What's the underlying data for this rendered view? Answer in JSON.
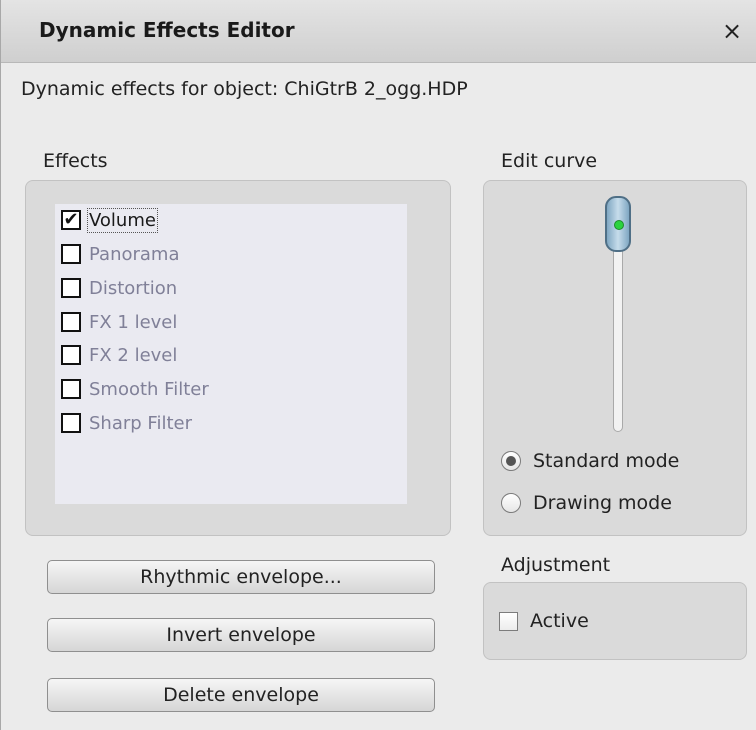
{
  "window": {
    "title": "Dynamic Effects Editor",
    "close_icon": "×"
  },
  "subtitle": "Dynamic effects for object: ChiGtrB 2_ogg.HDP",
  "effects": {
    "label": "Effects",
    "items": [
      {
        "label": "Volume",
        "checked": true
      },
      {
        "label": "Panorama",
        "checked": false
      },
      {
        "label": "Distortion",
        "checked": false
      },
      {
        "label": "FX 1 level",
        "checked": false
      },
      {
        "label": "FX 2 level",
        "checked": false
      },
      {
        "label": "Smooth Filter",
        "checked": false
      },
      {
        "label": "Sharp Filter",
        "checked": false
      }
    ],
    "check_mark": "✔"
  },
  "buttons": {
    "rhythmic": "Rhythmic envelope...",
    "invert": "Invert envelope",
    "delete": "Delete envelope"
  },
  "edit_curve": {
    "label": "Edit curve",
    "standard_mode": "Standard mode",
    "drawing_mode": "Drawing mode",
    "selected_mode": "standard",
    "slider_level": 1.0
  },
  "adjustment": {
    "label": "Adjustment",
    "active_label": "Active",
    "active_checked": false
  }
}
